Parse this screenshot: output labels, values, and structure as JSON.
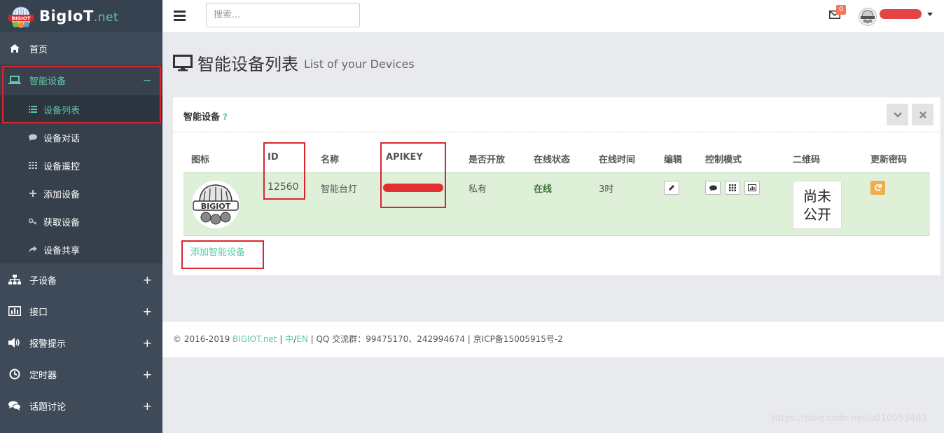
{
  "brand": {
    "name": "BigIoT",
    "suffix": ".net",
    "logo_text": "BIGIOT"
  },
  "sidebar": {
    "items": [
      {
        "label": "首页",
        "icon": "home-icon"
      },
      {
        "label": "智能设备",
        "icon": "laptop-icon",
        "toggle": "−",
        "active": true
      },
      {
        "label": "子设备",
        "icon": "sitemap-icon",
        "toggle": "+"
      },
      {
        "label": "接口",
        "icon": "bar-chart-icon",
        "toggle": "+"
      },
      {
        "label": "报警提示",
        "icon": "volume-icon",
        "toggle": "+"
      },
      {
        "label": "定时器",
        "icon": "clock-icon",
        "toggle": "+"
      },
      {
        "label": "话题讨论",
        "icon": "comments-icon",
        "toggle": "+"
      }
    ],
    "subitems": [
      {
        "label": "设备列表",
        "icon": "list-icon",
        "current": true
      },
      {
        "label": "设备对话",
        "icon": "comment-icon"
      },
      {
        "label": "设备遥控",
        "icon": "grid-icon"
      },
      {
        "label": "添加设备",
        "icon": "plus-icon"
      },
      {
        "label": "获取设备",
        "icon": "key-icon"
      },
      {
        "label": "设备共享",
        "icon": "share-icon"
      }
    ]
  },
  "topbar": {
    "search_placeholder": "搜索...",
    "mail_count": "0"
  },
  "page": {
    "title": "智能设备列表",
    "subtitle": "List of your Devices"
  },
  "panel": {
    "title": "智能设备",
    "help": "?",
    "headers": [
      "图标",
      "ID",
      "名称",
      "APIKEY",
      "是否开放",
      "在线状态",
      "在线时间",
      "编辑",
      "控制模式",
      "二维码",
      "更新密码"
    ],
    "row": {
      "id": "12560",
      "name": "智能台灯",
      "open": "私有",
      "status": "在线",
      "online_time": "3时",
      "qr_line1": "尚未",
      "qr_line2": "公开"
    },
    "add_link": "添加智能设备"
  },
  "footer": {
    "copy": "© 2016-2019 ",
    "site": "BIGIOT.net",
    "sep1": " | ",
    "zh": "中",
    "slash": "/",
    "en": "EN",
    "rest": " | QQ 交流群：99475170、242994674 | 京ICP备15005915号-2"
  },
  "watermark": "https://blog.csdn.net/u010053463",
  "colors": {
    "sidebar": "#3f4a58",
    "accent": "#5ec8a8",
    "highlight_box": "#d9262c",
    "row_success": "#dff0d8"
  }
}
